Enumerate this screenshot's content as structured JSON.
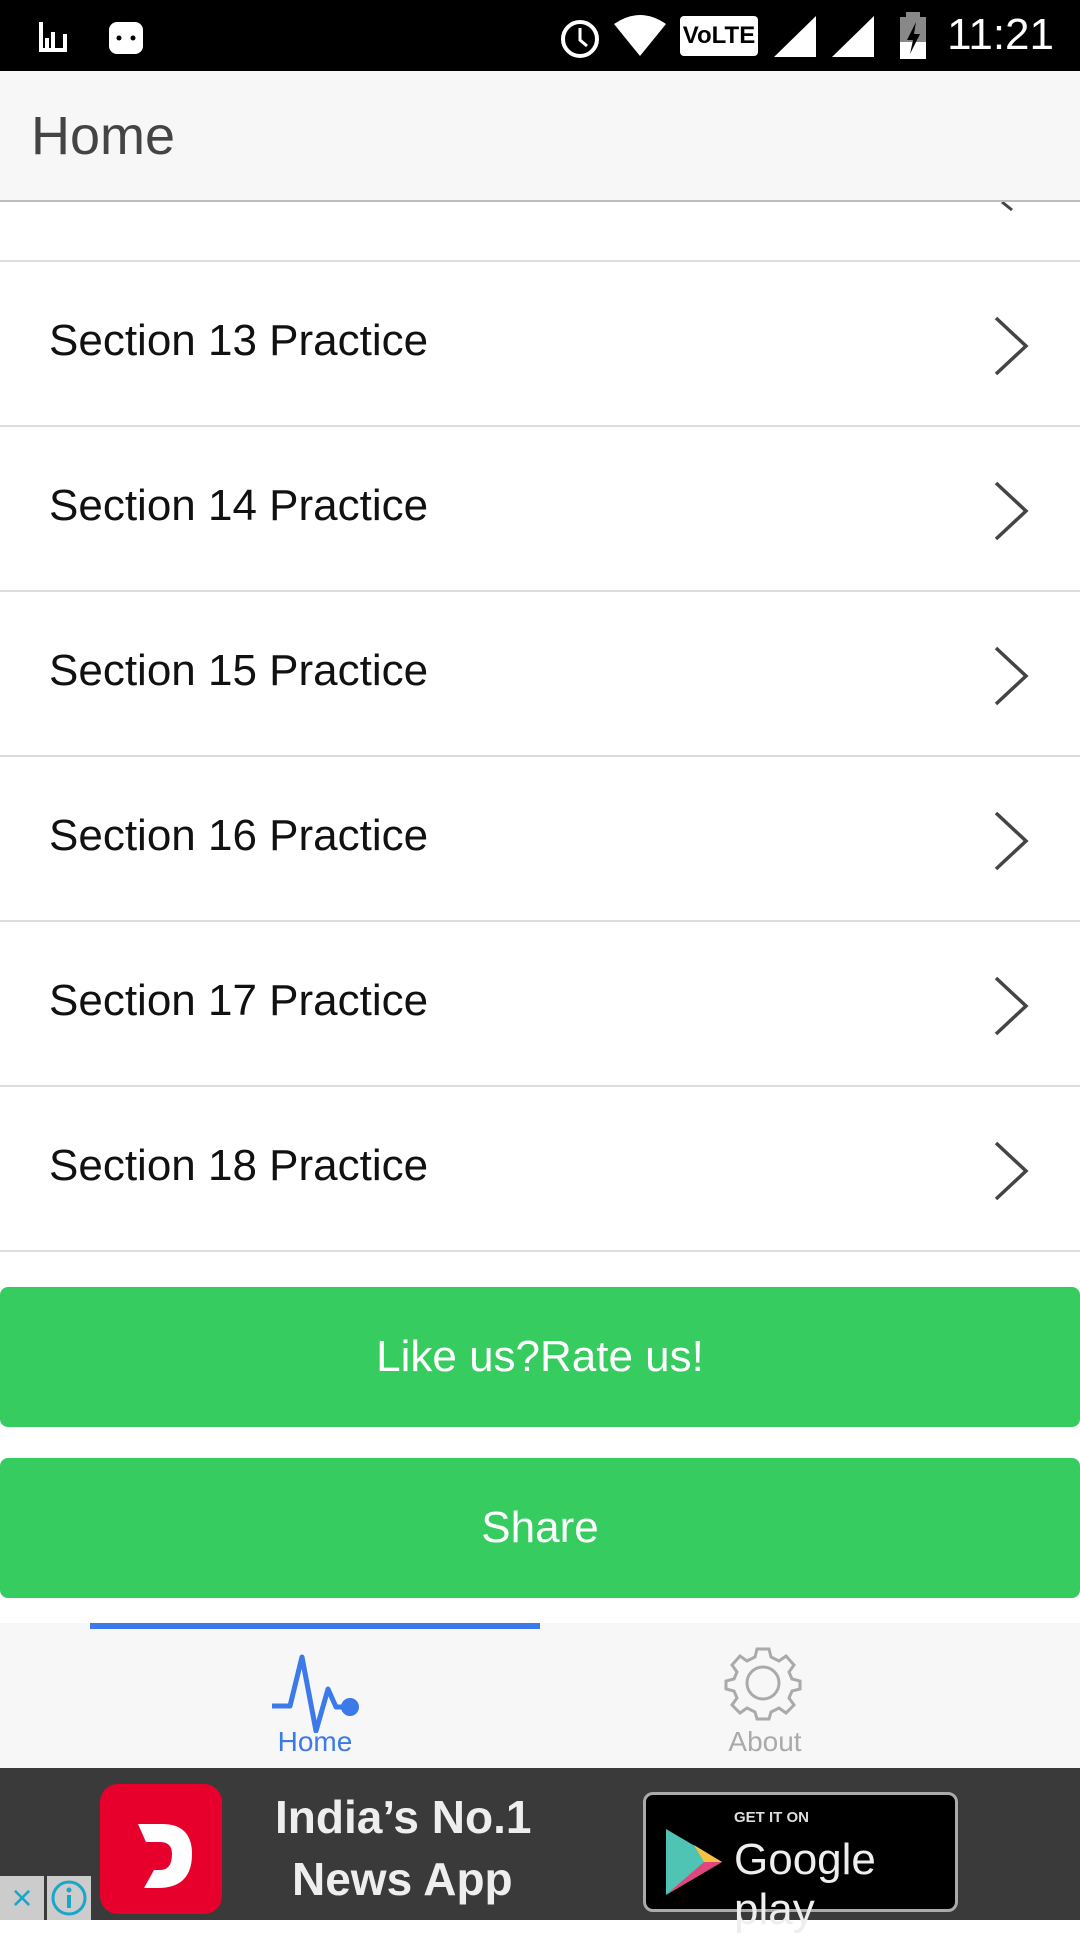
{
  "status_bar": {
    "time": "11:21",
    "icons": [
      "signal-app-icon",
      "android-icon",
      "alarm-icon",
      "wifi-icon",
      "volte-icon",
      "cell-signal-icon",
      "cell-signal-icon",
      "battery-charging-icon"
    ],
    "volte": "VoLTE"
  },
  "header": {
    "title": "Home"
  },
  "list": {
    "items": [
      {
        "label": "Section 13 Practice"
      },
      {
        "label": "Section 14 Practice"
      },
      {
        "label": "Section 15 Practice"
      },
      {
        "label": "Section 16 Practice"
      },
      {
        "label": "Section 17 Practice"
      },
      {
        "label": "Section 18 Practice"
      }
    ]
  },
  "buttons": {
    "rate": "Like us?Rate us!",
    "share": "Share"
  },
  "tabs": [
    {
      "label": "Home",
      "icon": "pulse-icon",
      "active": true
    },
    {
      "label": "About",
      "icon": "gear-icon",
      "active": false
    }
  ],
  "ad": {
    "headline_1": "India’s No.1",
    "headline_2": "News App",
    "store_small": "GET IT ON",
    "store_big": "Google play"
  },
  "colors": {
    "accent": "#3b7ae8",
    "button": "#36cc60",
    "inactive": "#aaaaaa"
  }
}
